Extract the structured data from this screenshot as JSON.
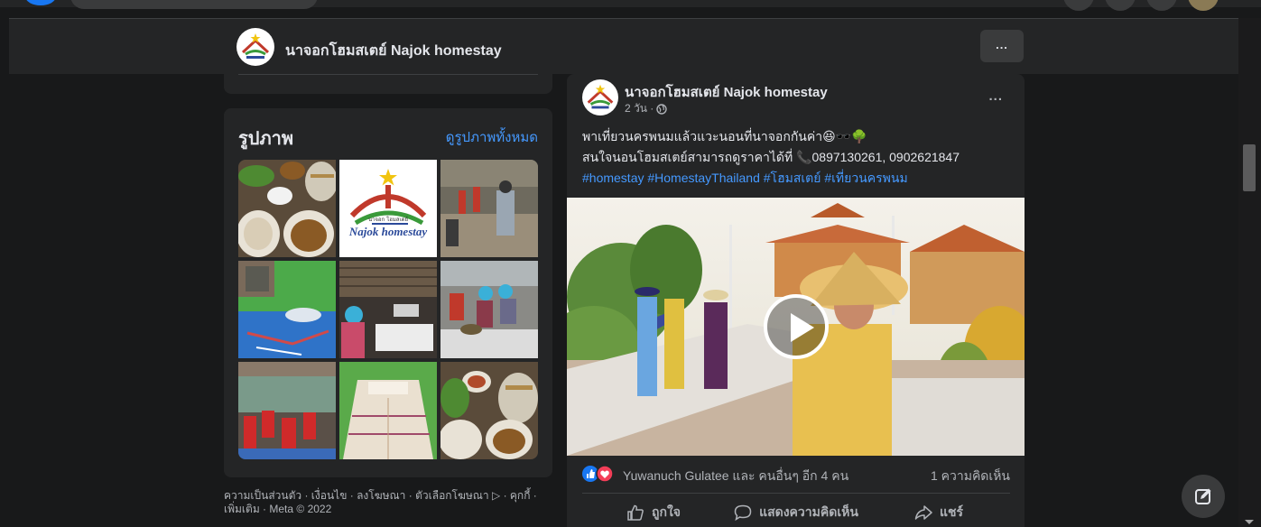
{
  "page": {
    "name": "นาจอกโฮมสเตย์ Najok homestay",
    "more_label": "..."
  },
  "photos": {
    "title": "รูปภาพ",
    "see_all_label": "ดูรูปภาพทั้งหมด",
    "logo_text": "Najok homestay",
    "logo_small_text": "นาจอก โฮมสเตย์"
  },
  "footer": {
    "line1": "ความเป็นส่วนตัว · เงื่อนไข · ลงโฆษณา · ตัวเลือกโฆษณา ▷ · คุกกี้ ·",
    "line2": "เพิ่มเติม · Meta © 2022"
  },
  "post": {
    "author": "นาจอกโฮมสเตย์ Najok homestay",
    "time": "2 วัน ·",
    "more_label": "...",
    "text_line1": "พาเที่ยวนครพนมแล้วแวะนอนที่นาจอกกันค่า😆🕶️🌳",
    "text_line2": "สนใจนอนโฮมสเตย์สามารถดูราคาได้ที่ 📞0897130261, 0902621847",
    "hashtags": "#homestay #HomestayThailand #โฮมสเตย์ #เที่ยวนครพนม",
    "reactions_text": "Yuwanuch Gulatee และ คนอื่นๆ อีก 4 คน",
    "comments_count": "1 ความคิดเห็น",
    "actions": {
      "like": "ถูกใจ",
      "comment": "แสดงความคิดเห็น",
      "share": "แชร์"
    }
  },
  "colors": {
    "background": "#18191a",
    "card": "#242526",
    "link": "#4599ff",
    "like_blue": "#1877f2",
    "love_red": "#f33e58"
  }
}
